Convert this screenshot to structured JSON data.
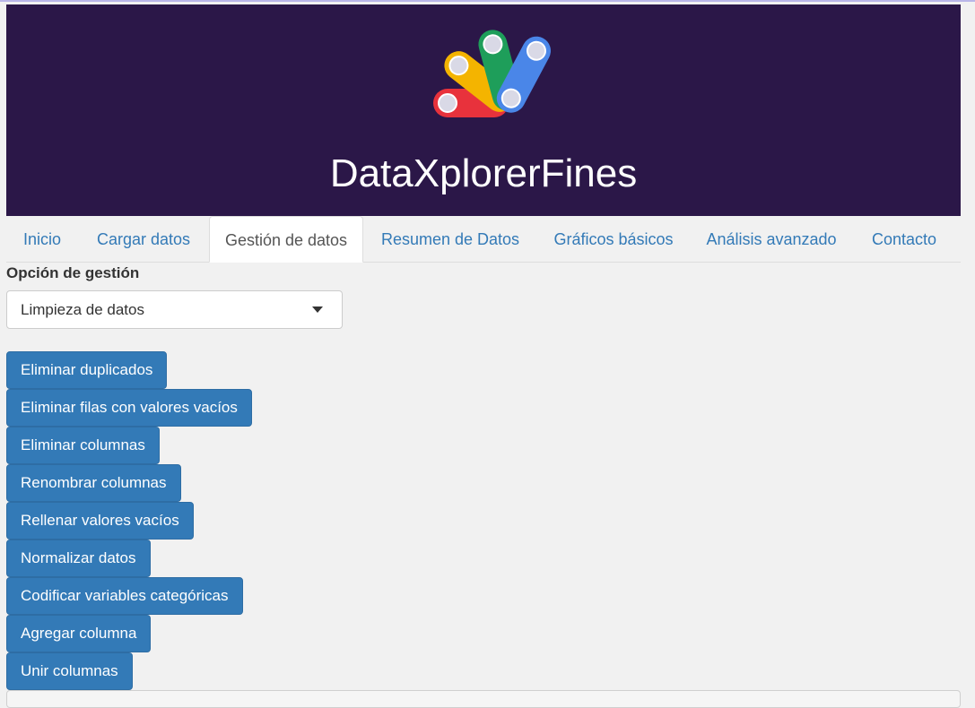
{
  "header": {
    "app_title": "DataXplorerFines",
    "logo_icon": "fan-of-colored-pills-logo",
    "background": "#2b1748"
  },
  "tabs": [
    {
      "label": "Inicio",
      "active": false
    },
    {
      "label": "Cargar datos",
      "active": false
    },
    {
      "label": "Gestión de datos",
      "active": true
    },
    {
      "label": "Resumen de Datos",
      "active": false
    },
    {
      "label": "Gráficos básicos",
      "active": false
    },
    {
      "label": "Análisis avanzado",
      "active": false
    },
    {
      "label": "Contacto",
      "active": false
    }
  ],
  "management": {
    "label": "Opción de gestión",
    "selected": "Limpieza de datos"
  },
  "actions": [
    {
      "label": "Eliminar duplicados"
    },
    {
      "label": "Eliminar filas con valores vacíos"
    },
    {
      "label": "Eliminar columnas"
    },
    {
      "label": "Renombrar columnas"
    },
    {
      "label": "Rellenar valores vacíos"
    },
    {
      "label": "Normalizar datos"
    },
    {
      "label": "Codificar variables categóricas"
    },
    {
      "label": "Agregar columna"
    },
    {
      "label": "Unir columnas"
    }
  ],
  "colors": {
    "primary_button": "#337ab7",
    "tab_link": "#337ab7",
    "page_background": "#f1f1f1"
  }
}
